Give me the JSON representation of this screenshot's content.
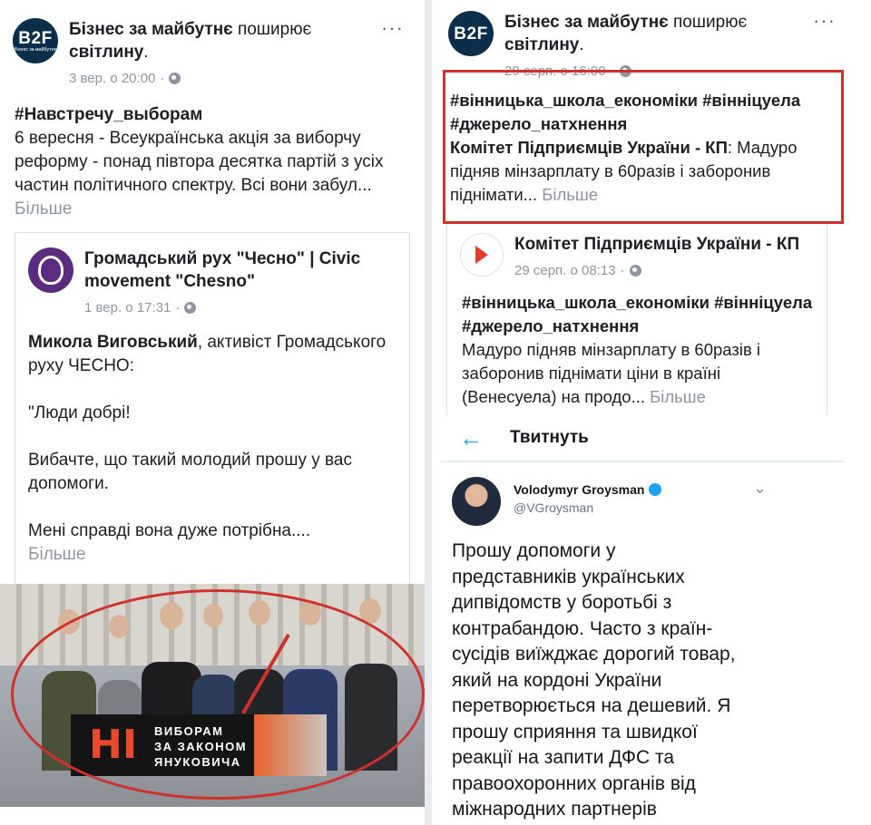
{
  "left_post": {
    "page_name": "Бізнес за майбутнє",
    "action": "поширює",
    "target": "світлину",
    "time": "3 вер. о 20:00",
    "menu": "···",
    "hashtag": "#Навстречу_выборам",
    "text": "6 вересня - Всеукраїнська акція за виборчу реформу - понад півтора десятка партій з усіх частин політичного спектру. Всі вони забул...",
    "more": "Більше",
    "shared": {
      "page_name": "Громадський рух \"Чесно\" | Civic movement \"Chesno\"",
      "time": "1 вер. о 17:31",
      "author": "Микола Виговський",
      "author_rest": ", активіст Громадського руху ЧЕСНО:",
      "line1": "\"Люди добрі!",
      "line2": "Вибачте, що такий молодий прошу у вас допомоги.",
      "line3": "Мені справді вона дуже потрібна....",
      "more": "Більше"
    },
    "banner": {
      "hi": "НІ",
      "line1": "ВИБОРАМ",
      "line2": "ЗА ЗАКОНОМ",
      "line3": "ЯНУКОВИЧА"
    },
    "avatar_text": "B2F",
    "avatar_sub": "бізнес за майбутнє"
  },
  "right_post": {
    "page_name": "Бізнес за майбутнє",
    "action": "поширює",
    "target": "світлину",
    "time": "29 серп. о 16:00",
    "menu": "···",
    "hashtags": "#вінницька_школа_економіки #вінніцуела #джерело_натхнення",
    "source": "Комітет Підприємців України - КП",
    "text": ": Мадуро підняв мінзарплату в 60разів і заборонив піднімати...",
    "more": "Більше",
    "avatar_text": "B2F",
    "shared": {
      "page_name": "Комітет Підприємців України - КП",
      "time": "29 серп. о 08:13",
      "hashtags": "#вінницька_школа_економіки #вінніцуела #джерело_натхнення",
      "text": "Мадуро підняв мінзарплату в 60разів і заборонив піднімати ціни в країні (Венесуела) на продо...",
      "more": "Більше"
    }
  },
  "tweet": {
    "bar_title": "Твитнуть",
    "name": "Volodymyr Groysman",
    "handle": "@VGroysman",
    "text": "Прошу допомоги у представників українських дипвідомств у боротьбі з контрабандою. Часто з країн-сусідів виїжджає дорогий товар, який на кордоні України перетворюється на дешевий. Я прошу сприяння та швидкої реакції на запити ДФС та правоохоронних органів від міжнародних партнерів"
  },
  "colors": {
    "highlight_red": "#d0312d",
    "twitter_blue": "#1da1f2",
    "muted": "#90949c"
  },
  "icons": [
    "globe-icon",
    "more-dots-icon",
    "back-arrow-icon",
    "verified-icon",
    "chevron-down-icon"
  ]
}
